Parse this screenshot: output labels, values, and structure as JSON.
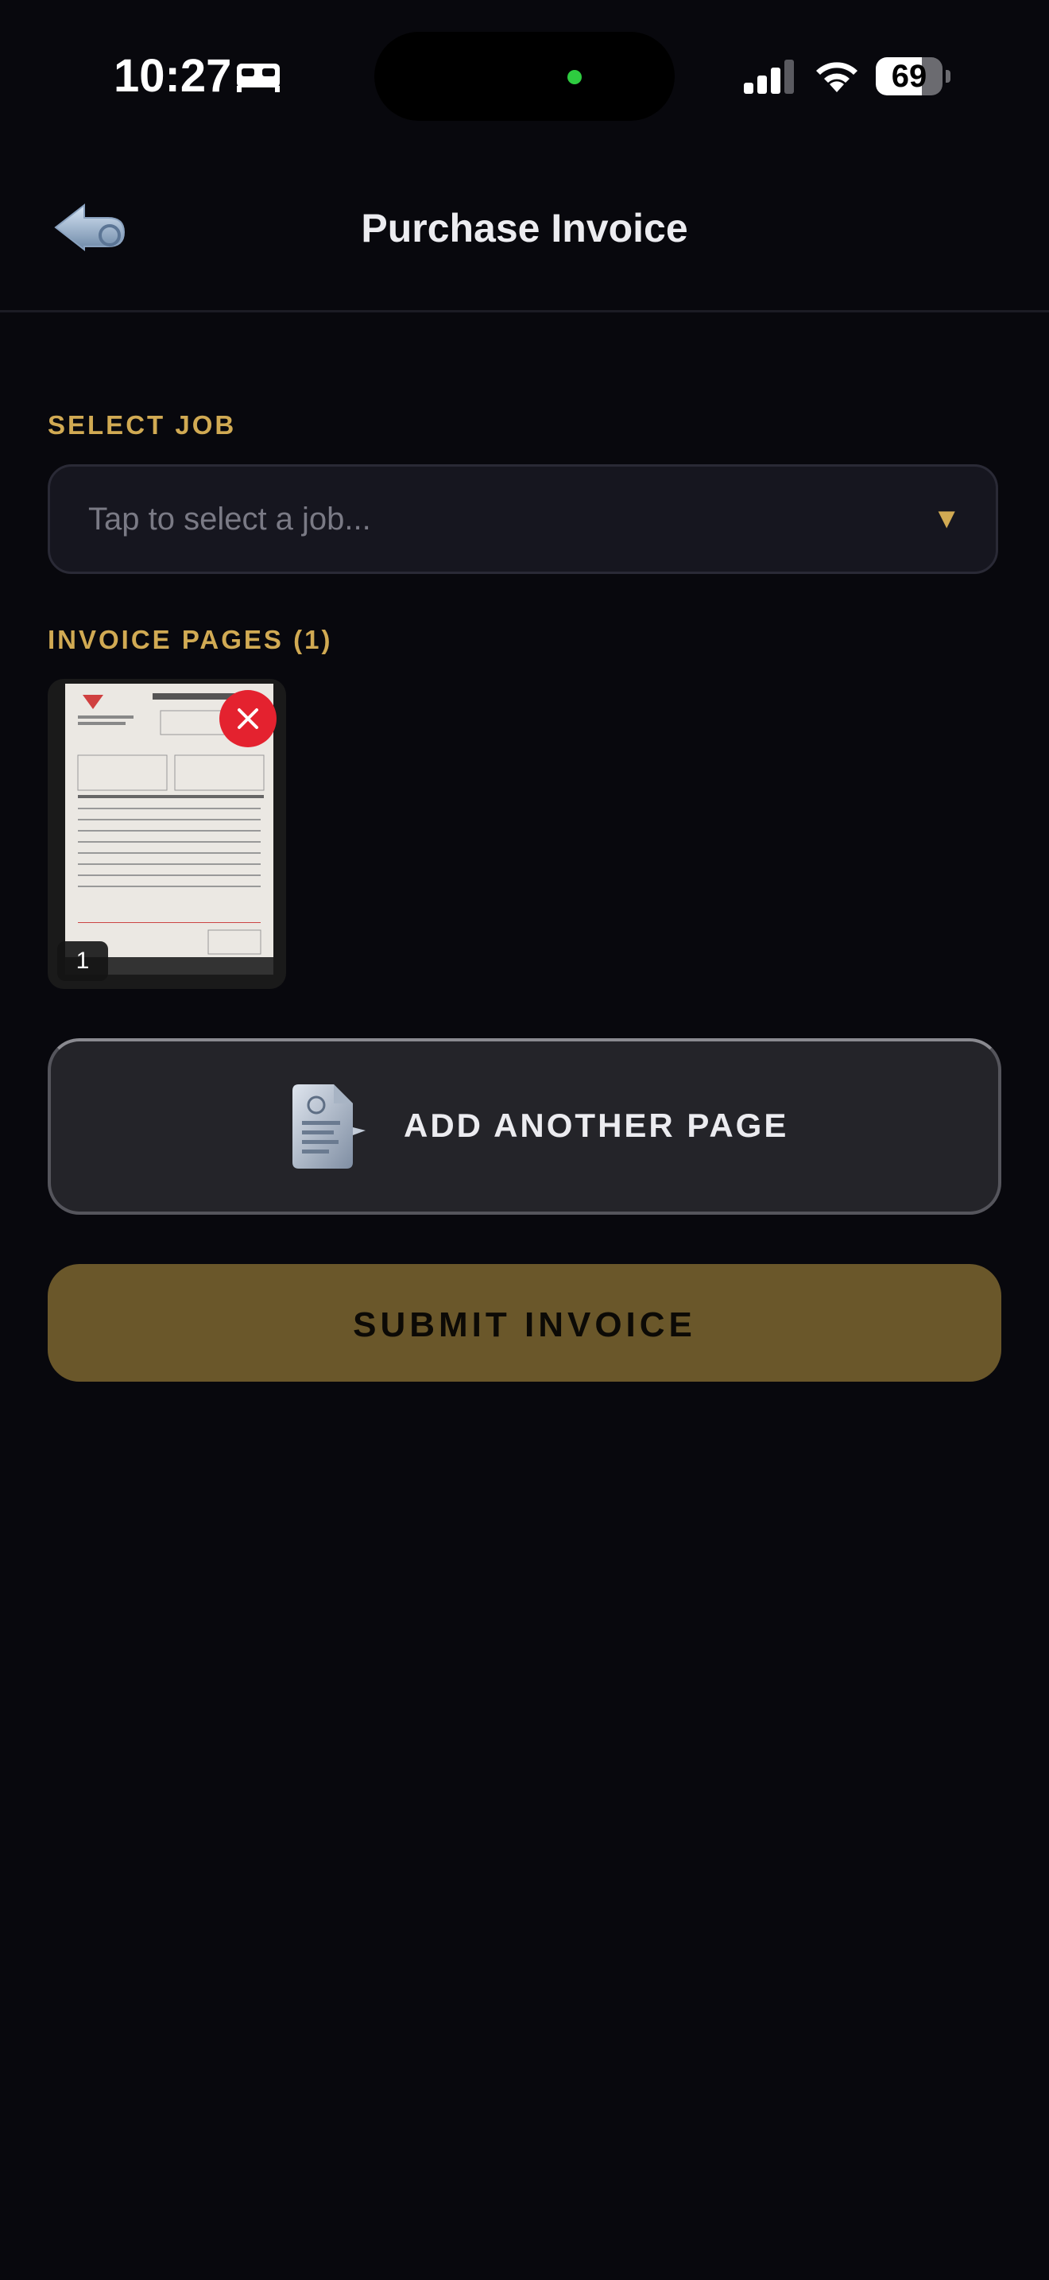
{
  "status_bar": {
    "time": "10:27",
    "battery_level": "69",
    "battery_fraction": 0.69,
    "icons": [
      "bed-icon",
      "cellular-signal-icon",
      "wifi-icon",
      "battery-icon"
    ]
  },
  "header": {
    "title": "Purchase Invoice",
    "back_icon": "back-arrow-icon"
  },
  "job_section": {
    "label": "SELECT JOB",
    "placeholder": "Tap to select a job...",
    "arrow": "▼"
  },
  "pages_section": {
    "label": "INVOICE PAGES (1)",
    "pages": [
      {
        "number": "1",
        "remove_icon": "close-icon"
      }
    ]
  },
  "add_page": {
    "label": "ADD ANOTHER PAGE",
    "icon": "document-scan-icon"
  },
  "submit": {
    "label": "SUBMIT INVOICE"
  },
  "colors": {
    "background": "#08080d",
    "accent_gold": "#d1aa53",
    "submit_bg": "#6a572a",
    "remove_red": "#e4222f",
    "field_bg": "#16161f"
  }
}
